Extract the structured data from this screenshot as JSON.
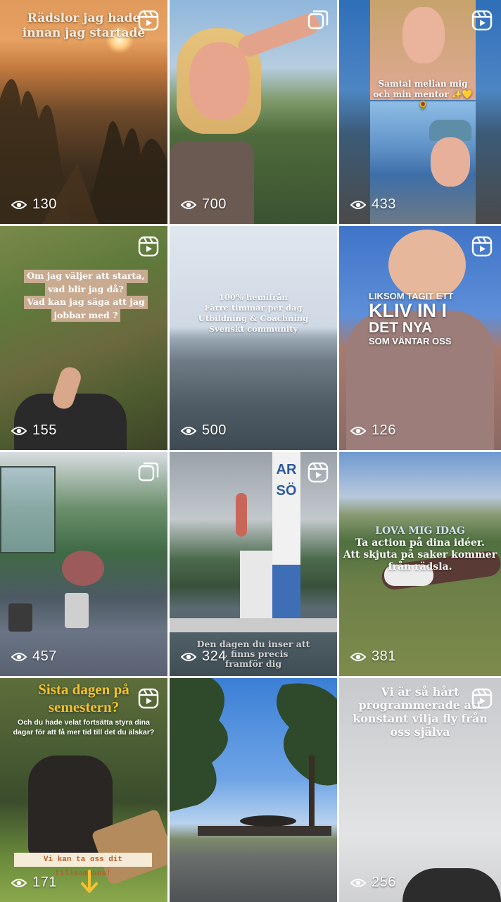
{
  "tiles": [
    {
      "views": "130",
      "badge": "reel-icon",
      "caption": [
        "Rädslor jag hade",
        "innan jag startade"
      ]
    },
    {
      "views": "700",
      "badge": "carousel-icon"
    },
    {
      "views": "433",
      "badge": "reel-icon",
      "caption": [
        "Samtal mellan mig",
        "och min mentor ✨💛🌻"
      ]
    },
    {
      "views": "155",
      "badge": "reel-icon",
      "caption": [
        "Om jag väljer att starta,",
        "vad blir jag då?",
        "Vad kan jag säga att jag",
        "jobbar med ?"
      ]
    },
    {
      "views": "500",
      "caption": [
        "100% hemifrån",
        "Färre timmar per dag",
        "Utbildning & Coachning",
        "Svenskt community"
      ]
    },
    {
      "views": "126",
      "badge": "reel-icon",
      "caption_small_1": "LIKSOM TAGIT ETT",
      "caption_big": "KLIV IN I",
      "caption_mid": "DET NYA",
      "caption_small_2": "SOM VÄNTAR OSS"
    },
    {
      "views": "457",
      "badge": "carousel-icon"
    },
    {
      "views": "324",
      "badge": "reel-icon",
      "sign": "ARSÖ",
      "caption": [
        "Den dagen du inser att",
        "... finns precis",
        "framför dig"
      ]
    },
    {
      "views": "381",
      "caption_title": "LOVA MIG IDAG",
      "caption": [
        "Ta action på dina idéer.",
        "Att skjuta på saker kommer",
        "från rädsla."
      ]
    },
    {
      "views": "171",
      "badge": "reel-icon",
      "caption_title": [
        "Sista dagen på",
        "semestern?"
      ],
      "caption": [
        "Och du hade velat fortsätta styra dina",
        "dagar för att få mer tid till det du älskar?"
      ],
      "footer": "Vi kan ta oss dit tillsammans!"
    },
    {
      "views": "",
      "badge": ""
    },
    {
      "views": "256",
      "badge": "reel-icon",
      "caption": [
        "Vi är så hårt",
        "programmerade att",
        "konstant vilja fly från",
        "oss själva"
      ]
    }
  ],
  "colors": {
    "accent_yellow": "#f2c230",
    "text": "#ffffff"
  }
}
